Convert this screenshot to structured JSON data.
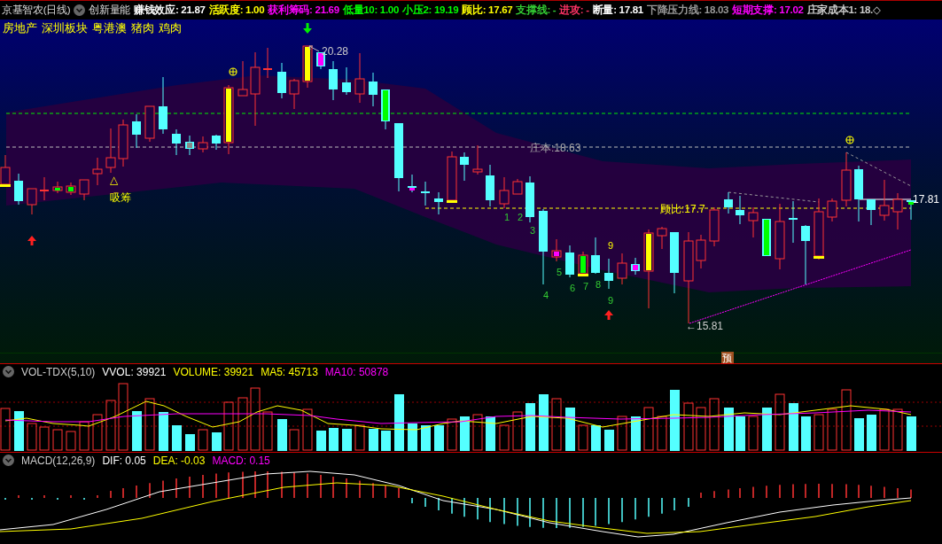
{
  "title_bar": {
    "stock": "京基智农(日线)",
    "indicator": "创新量能",
    "items": [
      {
        "text": "赚钱效应: 21.87",
        "color": "#ffffff"
      },
      {
        "text": "活跃度: 1.00",
        "color": "#ffff00"
      },
      {
        "text": "获利筹码: 21.69",
        "color": "#ff00ff"
      },
      {
        "text": "低量10: 1.00",
        "color": "#00ff00"
      },
      {
        "text": "小压2: 19.19",
        "color": "#00ff00"
      },
      {
        "text": "顾比: 17.67",
        "color": "#ffff00"
      },
      {
        "text": "支撑线: -",
        "color": "#33cc33"
      },
      {
        "text": "进攻: -",
        "color": "#ff3366"
      },
      {
        "text": "断量: 17.81",
        "color": "#ffffff"
      },
      {
        "text": "下降压力线: 18.03",
        "color": "#999999"
      },
      {
        "text": "短期支撑: 17.02",
        "color": "#ff00ff"
      },
      {
        "text": "庄家成本1: 18.◇",
        "color": "#cccccc"
      }
    ]
  },
  "sectors": [
    "房地产",
    "深圳板块",
    "粤港澳",
    "猪肉",
    "鸡肉"
  ],
  "main_chart": {
    "high_label": "20.28",
    "cost_line_label": "庄本:18.63",
    "gubi_line_label": "顾比:17.7",
    "low_label": "←15.81",
    "last_price_label": "17.81",
    "accumulate_label": "吸筹",
    "triangle_mark": "△",
    "count_labels": [
      "1",
      "2",
      "3",
      "4",
      "5",
      "6",
      "7",
      "8",
      "9"
    ],
    "setup_label": "9",
    "forecast_badge": "预"
  },
  "volume_panel": {
    "title": "VOL-TDX(5,10)",
    "items": [
      {
        "text": "VVOL: 39921",
        "color": "#ffffff"
      },
      {
        "text": "VOLUME: 39921",
        "color": "#ffff00"
      },
      {
        "text": "MA5: 45713",
        "color": "#ffff00"
      },
      {
        "text": "MA10: 50878",
        "color": "#ff00ff"
      }
    ]
  },
  "macd_panel": {
    "title": "MACD(12,26,9)",
    "items": [
      {
        "text": "DIF: 0.05",
        "color": "#ffffff"
      },
      {
        "text": "DEA: -0.03",
        "color": "#ffff00"
      },
      {
        "text": "MACD: 0.15",
        "color": "#ff00ff"
      }
    ]
  }
}
